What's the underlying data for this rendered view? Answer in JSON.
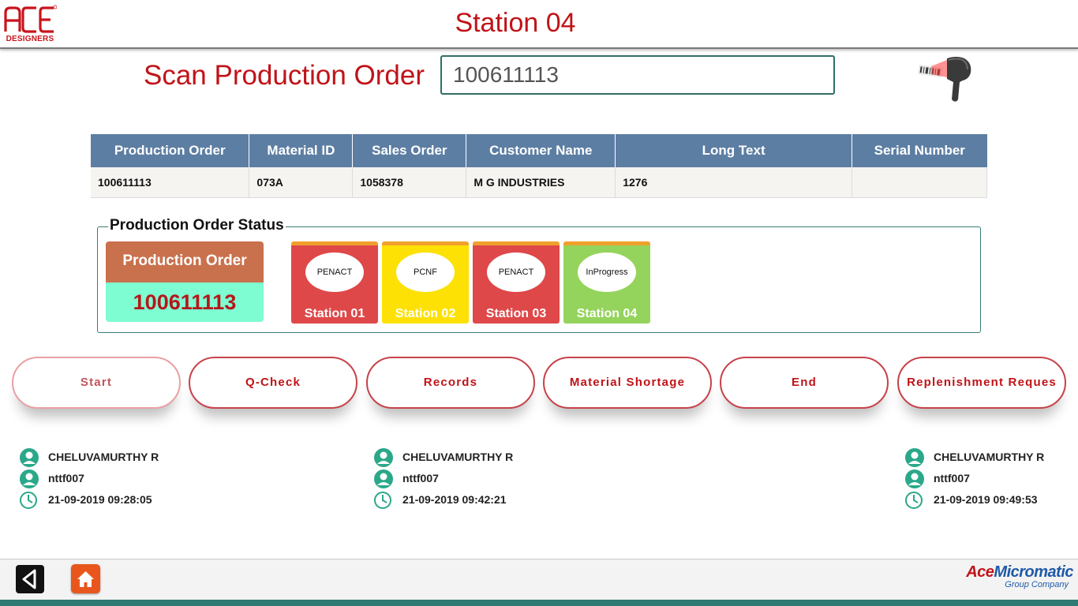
{
  "header": {
    "logo_text": "ACE",
    "logo_subtext": "DESIGNERS",
    "title": "Station 04"
  },
  "scan": {
    "label": "Scan Production Order",
    "value": "100611113"
  },
  "table": {
    "columns": [
      "Production Order",
      "Material ID",
      "Sales Order",
      "Customer Name",
      "Long Text",
      "Serial Number"
    ],
    "rows": [
      [
        "100611113",
        "073A",
        "1058378",
        "M G INDUSTRIES",
        "1276",
        ""
      ]
    ]
  },
  "status": {
    "legend": "Production Order Status",
    "po_label": "Production Order",
    "po_number": "100611113",
    "stations": [
      {
        "status": "PENACT",
        "name": "Station 01",
        "color": "#de4849"
      },
      {
        "status": "PCNF",
        "name": "Station 02",
        "color": "#fde105"
      },
      {
        "status": "PENACT",
        "name": "Station 03",
        "color": "#de4849"
      },
      {
        "status": "InProgress",
        "name": "Station 04",
        "color": "#95d45c"
      }
    ]
  },
  "actions": {
    "start": "Start",
    "qcheck": "Q-Check",
    "records": "Records",
    "shortage": "Material Shortage",
    "end": "End",
    "replenish": "Replenishment Reques"
  },
  "info": [
    {
      "name": "CHELUVAMURTHY R",
      "id": "nttf007",
      "time": "21-09-2019 09:28:05"
    },
    {
      "name": "CHELUVAMURTHY R",
      "id": "nttf007",
      "time": "21-09-2019 09:42:21"
    },
    {
      "name": "CHELUVAMURTHY R",
      "id": "nttf007",
      "time": "21-09-2019 09:49:53"
    }
  ],
  "footer": {
    "brand_part1": "Ace",
    "brand_part2": "Micromatic",
    "brand_sub": "Group Company"
  },
  "colors": {
    "accent_red": "#c01318",
    "table_header": "#5d7ea3",
    "teal": "#2f7a72",
    "station_red": "#de4849",
    "station_yellow": "#fde105",
    "station_green": "#95d45c"
  },
  "icons": [
    "scanner-icon",
    "user-icon",
    "clock-icon",
    "back-icon",
    "home-icon"
  ]
}
